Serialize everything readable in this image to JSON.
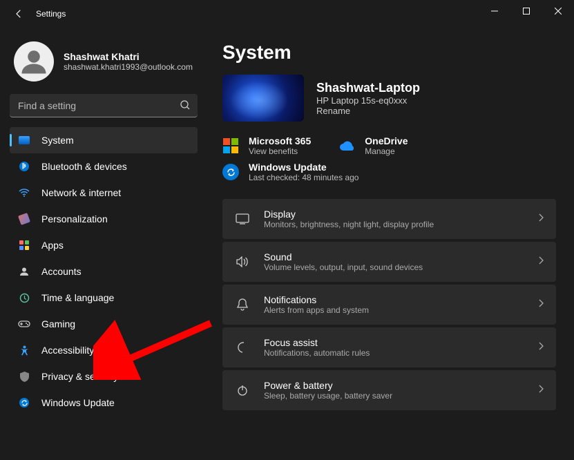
{
  "window": {
    "title": "Settings"
  },
  "user": {
    "name": "Shashwat Khatri",
    "email": "shashwat.khatri1993@outlook.com"
  },
  "search": {
    "placeholder": "Find a setting"
  },
  "sidebar": {
    "items": [
      {
        "label": "System",
        "active": true
      },
      {
        "label": "Bluetooth & devices"
      },
      {
        "label": "Network & internet"
      },
      {
        "label": "Personalization"
      },
      {
        "label": "Apps"
      },
      {
        "label": "Accounts"
      },
      {
        "label": "Time & language"
      },
      {
        "label": "Gaming"
      },
      {
        "label": "Accessibility"
      },
      {
        "label": "Privacy & security"
      },
      {
        "label": "Windows Update"
      }
    ]
  },
  "page": {
    "heading": "System",
    "device": {
      "name": "Shashwat-Laptop",
      "model": "HP Laptop 15s-eq0xxx",
      "rename": "Rename"
    },
    "quick": {
      "ms365": {
        "title": "Microsoft 365",
        "sub": "View benefits"
      },
      "onedrive": {
        "title": "OneDrive",
        "sub": "Manage"
      },
      "wu": {
        "title": "Windows Update",
        "sub": "Last checked: 48 minutes ago"
      }
    },
    "items": [
      {
        "title": "Display",
        "sub": "Monitors, brightness, night light, display profile"
      },
      {
        "title": "Sound",
        "sub": "Volume levels, output, input, sound devices"
      },
      {
        "title": "Notifications",
        "sub": "Alerts from apps and system"
      },
      {
        "title": "Focus assist",
        "sub": "Notifications, automatic rules"
      },
      {
        "title": "Power & battery",
        "sub": "Sleep, battery usage, battery saver"
      }
    ]
  }
}
